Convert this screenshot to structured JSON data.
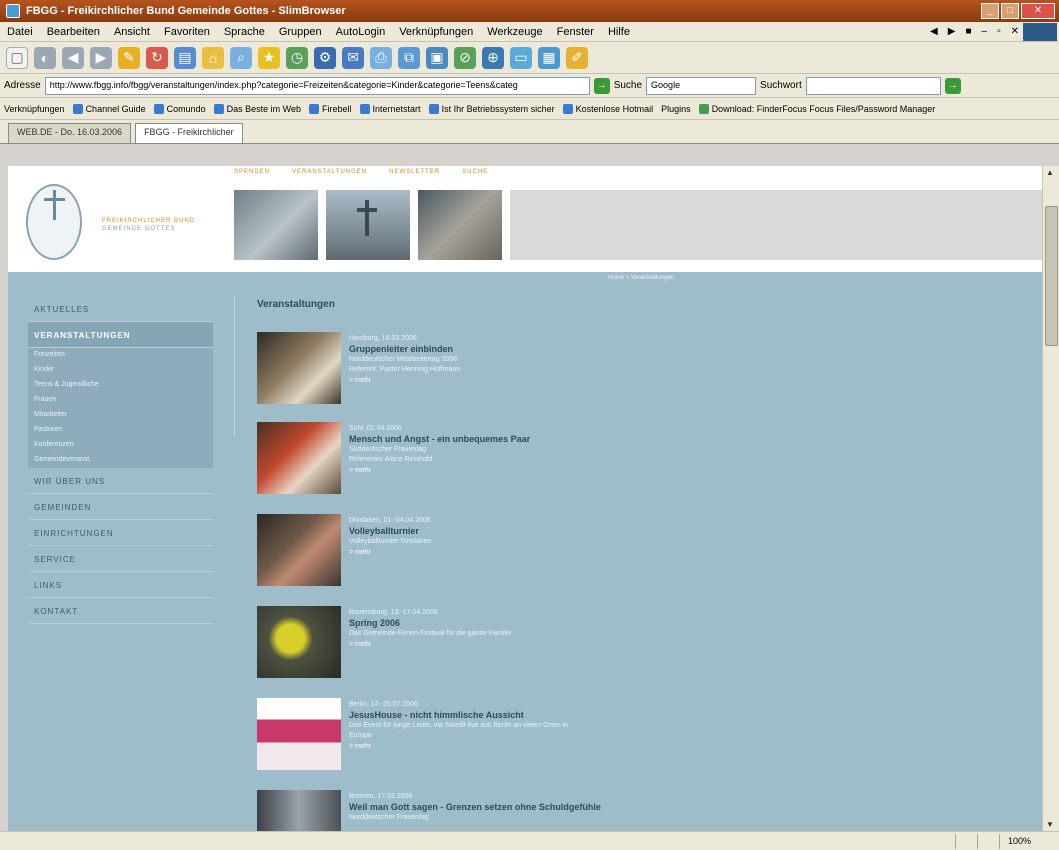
{
  "window": {
    "title": "FBGG - Freikirchlicher Bund Gemeinde Gottes - SlimBrowser"
  },
  "menu": {
    "items": [
      "Datei",
      "Bearbeiten",
      "Ansicht",
      "Favoriten",
      "Sprache",
      "Gruppen",
      "AutoLogin",
      "Verknüpfungen",
      "Werkzeuge",
      "Fenster",
      "Hilfe"
    ]
  },
  "address": {
    "label": "Adresse",
    "url": "http://www.fbgg.info/fbgg/veranstaltungen/index.php?categorie=Freizeiten&categorie=Kinder&categorie=Teens&categ",
    "search_label": "Suche",
    "search_engine": "Google",
    "search_field_label": "Suchwort"
  },
  "links": {
    "label": "Verknüpfungen",
    "items": [
      "Channel Guide",
      "Comundo",
      "Das Beste im Web",
      "Firebell",
      "Internetstart",
      "Ist Ihr Betriebssystem sicher",
      "Kostenlose Hotmail",
      "Plugins",
      "Download: FinderFocus Focus Files/Password Manager"
    ]
  },
  "tabs": [
    {
      "label": "WEB.DE - Do. 16.03.2006"
    },
    {
      "label": "FBGG - Freikirchlicher"
    }
  ],
  "site": {
    "topnav": [
      "SPENDEN",
      "VERANSTALTUNGEN",
      "NEWSLETTER",
      "SUCHE"
    ],
    "logo_line1": "FREIKIRCHLICHER BUND",
    "logo_line2": "GEMEINDE GOTTES",
    "breadcrumb": "Home > Veranstaltungen"
  },
  "sidebar": {
    "items": [
      {
        "label": "AKTUELLES"
      },
      {
        "label": "VERANSTALTUNGEN"
      }
    ],
    "subitems": [
      "Freizeiten",
      "Kinder",
      "Teens & Jugendliche",
      "Frauen",
      "Mitarbeiter",
      "Pastoren",
      "Konferenzen",
      "Gemeindeveranst."
    ],
    "items_after": [
      "WIR ÜBER UNS",
      "GEMEINDEN",
      "EINRICHTUNGEN",
      "SERVICE",
      "LINKS",
      "KONTAKT"
    ]
  },
  "content": {
    "title": "Veranstaltungen",
    "events": [
      {
        "date": "Hamburg, 18.03.2006",
        "title": "Gruppenleiter einbinden",
        "sub1": "Norddeutscher Mitarbeitertag 2006",
        "sub2": "Referent: Pastor Henning Hoffmann",
        "more": "> mehr"
      },
      {
        "date": "Suhl, 01.04.2006",
        "title": "Mensch und Angst - ein unbequemes Paar",
        "sub1": "Süddeutscher Frauentag",
        "sub2": "Referentin: Alena Reinhold",
        "more": "> mehr"
      },
      {
        "date": "Dinslaken, 01.-04.04.2006",
        "title": "Volleyballturnier",
        "sub1": "Volleyballturnier Dinslaken",
        "sub2": "",
        "more": "> mehr"
      },
      {
        "date": "Ravensburg, 13.-17.04.2006",
        "title": "Spring 2006",
        "sub1": "Das Gemeinde-Ferien-Festival für die ganze Familie",
        "sub2": "",
        "more": "> mehr"
      },
      {
        "date": "Berlin, 14.-20.07.2006",
        "title": "JesusHouse - nicht himmlische Aussicht",
        "sub1": "Das Event für junge Leute, via Satellit live aus Berlin an vielen Orten in",
        "sub2": "Europa",
        "more": "> mehr"
      },
      {
        "date": "Bremen, 17.03.2006",
        "title": "Weil man Gott sagen - Grenzen setzen ohne Schuldgefühle",
        "sub1": "Norddeutscher Frauentag",
        "sub2": "",
        "more": ""
      }
    ]
  },
  "status": {
    "zoom": "100%"
  }
}
